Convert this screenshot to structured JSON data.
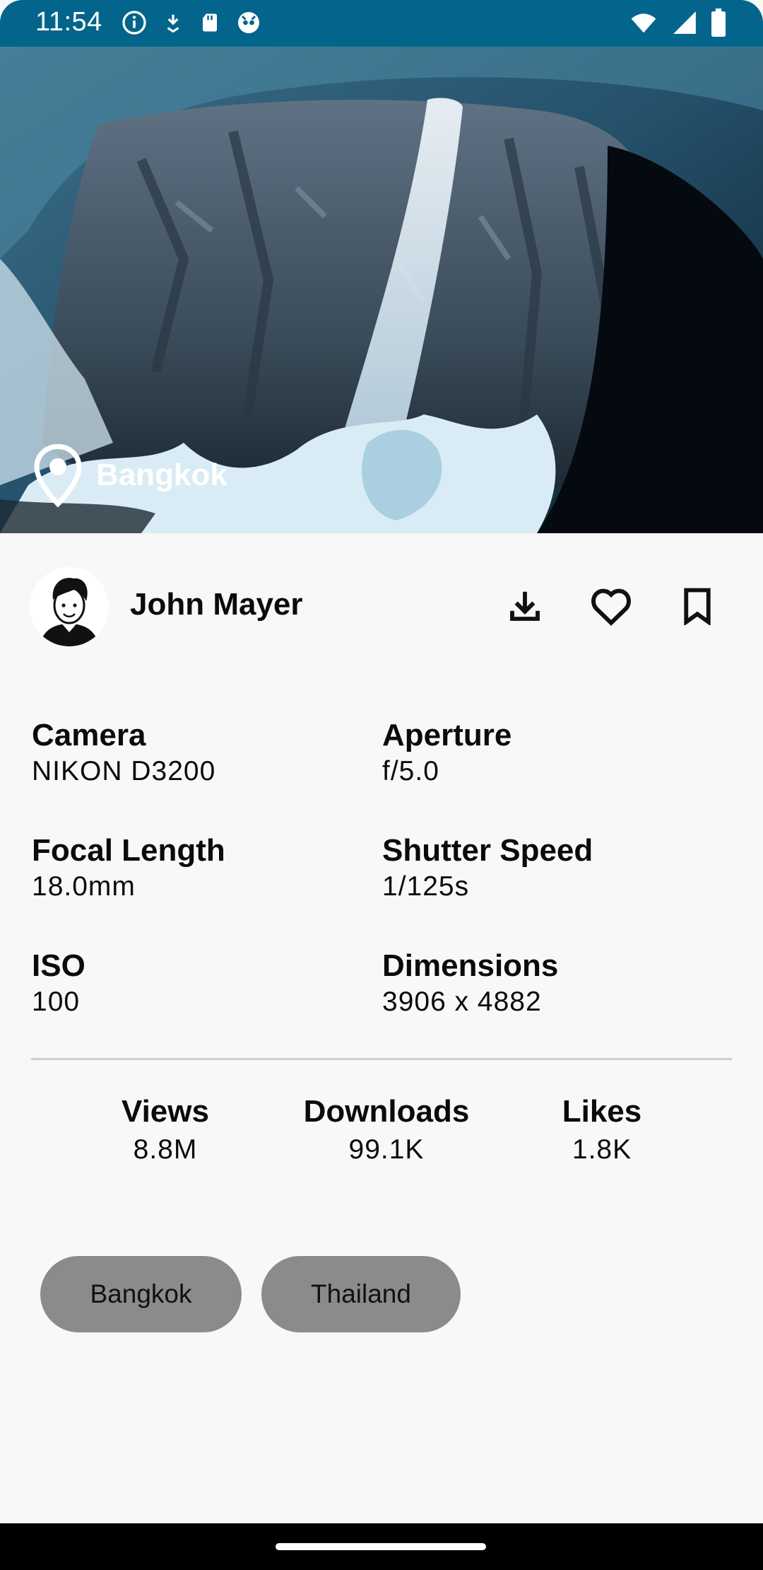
{
  "status_bar": {
    "time": "11:54",
    "left_icons": [
      "info-icon",
      "download-notification-icon",
      "sd-card-icon",
      "app-notification-icon"
    ],
    "right_icons": [
      "wifi-icon",
      "signal-icon",
      "battery-icon"
    ]
  },
  "photo": {
    "location": "Bangkok"
  },
  "author": {
    "name": "John Mayer"
  },
  "actions": [
    "download-icon",
    "heart-icon",
    "bookmark-icon"
  ],
  "exif": [
    {
      "label": "Camera",
      "value": "NIKON D3200"
    },
    {
      "label": "Aperture",
      "value": "f/5.0"
    },
    {
      "label": "Focal Length",
      "value": "18.0mm"
    },
    {
      "label": "Shutter Speed",
      "value": "1/125s"
    },
    {
      "label": "ISO",
      "value": "100"
    },
    {
      "label": "Dimensions",
      "value": "3906 x 4882"
    }
  ],
  "stats": [
    {
      "label": "Views",
      "value": "8.8M"
    },
    {
      "label": "Downloads",
      "value": "99.1K"
    },
    {
      "label": "Likes",
      "value": "1.8K"
    }
  ],
  "tags": [
    "Bangkok",
    "Thailand"
  ],
  "colors": {
    "status_bar": "#03658c",
    "background": "#f8f8f8",
    "tag_chip": "#8b8b8b"
  }
}
